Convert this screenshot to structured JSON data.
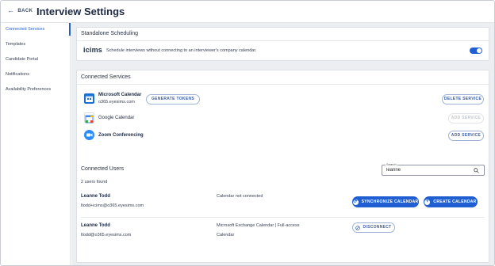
{
  "header": {
    "back_label": "BACK",
    "title": "Interview Settings"
  },
  "sidebar": {
    "items": [
      {
        "label": "Connected Services",
        "active": true
      },
      {
        "label": "Templates",
        "active": false
      },
      {
        "label": "Candidate Portal",
        "active": false
      },
      {
        "label": "Notifications",
        "active": false
      },
      {
        "label": "Availability Preferences",
        "active": false
      }
    ]
  },
  "standalone": {
    "title": "Standalone Scheduling",
    "logo_text": "icims",
    "description": "Schedule interviews without connecting to an interviewer's company calendar.",
    "toggle_on": true
  },
  "services": {
    "title": "Connected Services",
    "items": [
      {
        "name": "Microsoft Calendar",
        "sub": "o365.eyesims.com",
        "icon": "microsoft-calendar-icon",
        "left_button": "GENERATE TOKENS",
        "right_button": "DELETE SERVICE",
        "right_disabled": false
      },
      {
        "name": "Google Calendar",
        "sub": "",
        "icon": "google-calendar-icon",
        "left_button": "",
        "right_button": "ADD SERVICE",
        "right_disabled": true
      },
      {
        "name": "Zoom Conferencing",
        "sub": "",
        "icon": "zoom-icon",
        "left_button": "",
        "right_button": "ADD SERVICE",
        "right_disabled": false
      }
    ]
  },
  "users": {
    "title": "Connected Users",
    "search_label": "Search",
    "search_value": "leanne",
    "count_text": "2 users found",
    "rows": [
      {
        "name": "Leanne Todd",
        "email": "ltodd+icims@o365.eyesims.com",
        "status_line1": "Calendar not connected",
        "status_line2": "",
        "btn_sync": "SYNCHRONIZE CALENDAR",
        "btn_create": "CREATE CALENDAR"
      },
      {
        "name": "Leanne Todd",
        "email": "ltodd@o365.eyesims.com",
        "status_line1": "Microsoft Exchange Calendar | Full-access",
        "status_line2": "Calendar",
        "btn_disconnect": "DISCONNECT"
      }
    ]
  },
  "colors": {
    "accent": "#1f5fd1",
    "background": "#eceef1"
  }
}
